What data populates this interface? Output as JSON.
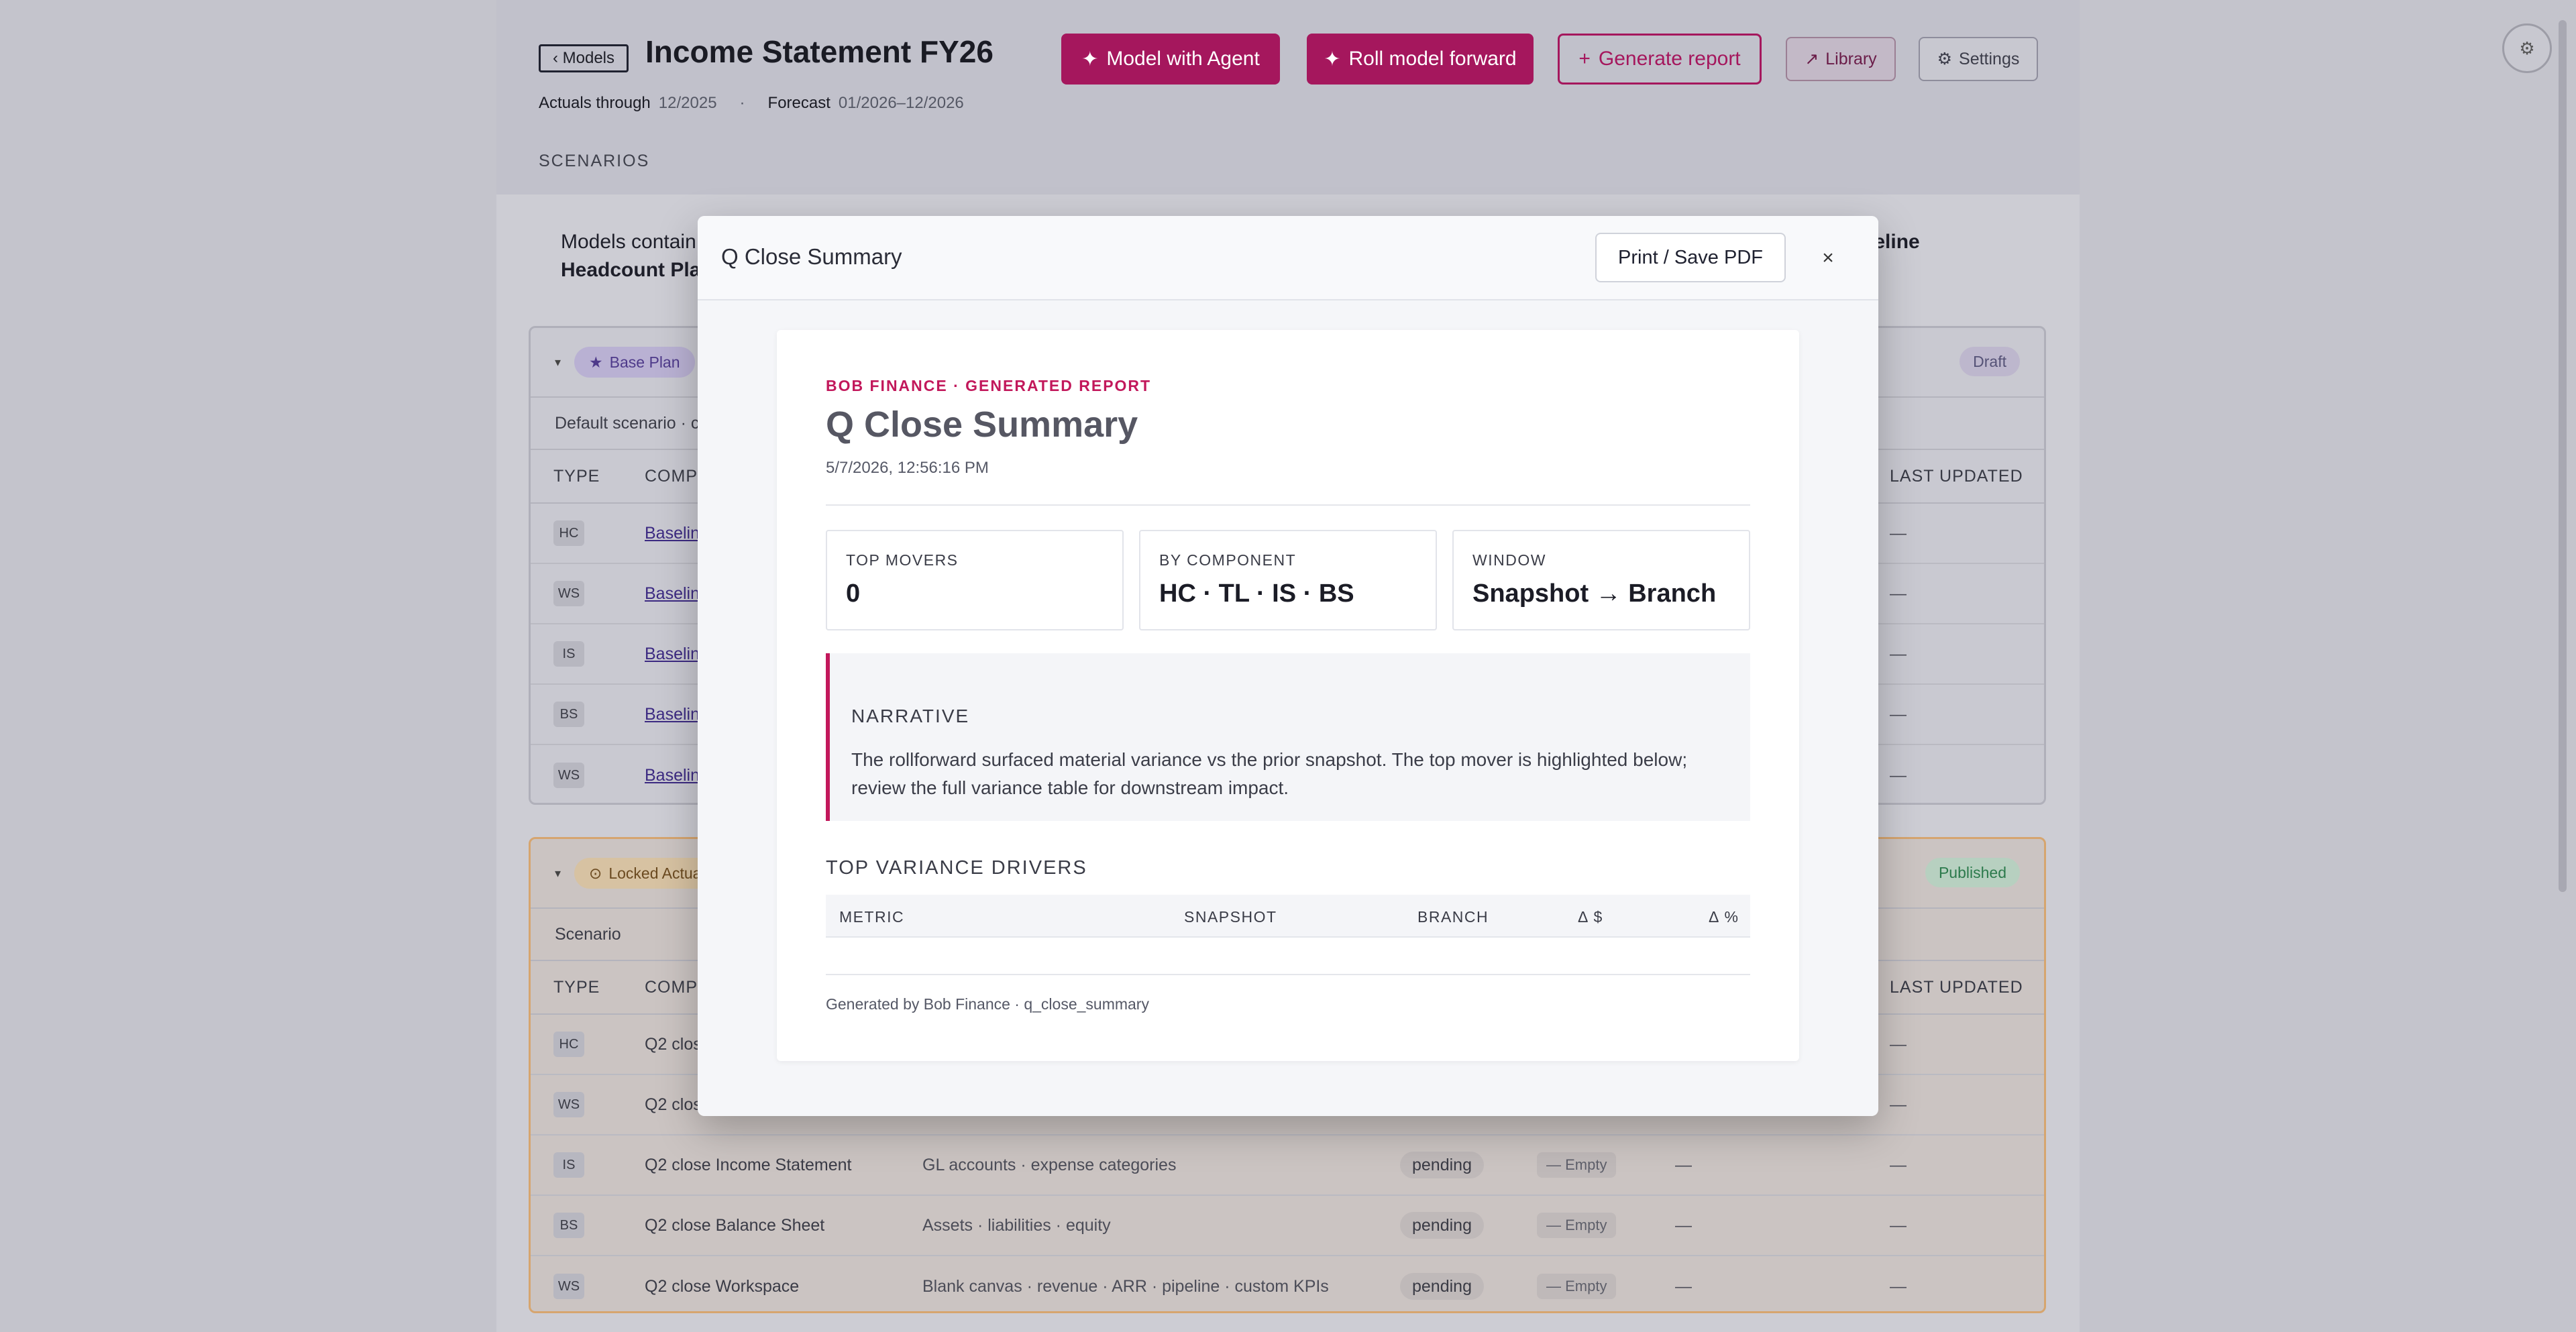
{
  "header": {
    "back_label": "‹ Models",
    "title": "Income Statement FY26",
    "actuals_label": "Actuals through",
    "actuals_value": "12/2025",
    "sep": "·",
    "forecast_label": "Forecast",
    "forecast_value": "01/2026–12/2026",
    "scenarios_label": "SCENARIOS"
  },
  "toolbar": {
    "model_agent": "Model with Agent",
    "roll_forward": "Roll model forward",
    "generate_report": "Generate report",
    "library": "Library",
    "settings": "Settings"
  },
  "info": {
    "line1": "Models contain",
    "line2": "Headcount Plan",
    "right1": "aseline"
  },
  "base_card": {
    "chip": "Base Plan",
    "status": "Draft",
    "sub": "Default scenario · c",
    "cols": {
      "type": "TYPE",
      "component": "COMPO",
      "last_updated": "LAST UPDATED"
    },
    "rows": [
      {
        "type": "HC",
        "comp": "Baselin",
        "updated": "—"
      },
      {
        "type": "WS",
        "comp": "Baselin",
        "updated": "—"
      },
      {
        "type": "IS",
        "comp": "Baselin",
        "updated": "—"
      },
      {
        "type": "BS",
        "comp": "Baselin",
        "updated": "—"
      },
      {
        "type": "WS",
        "comp": "Baselin",
        "updated": "—"
      }
    ]
  },
  "locked_card": {
    "chip": "Locked Actua",
    "status": "Published",
    "sub": "Scenario",
    "cols": {
      "type": "TYPE",
      "component": "COMPO",
      "last_updated": "LAST UPDATED"
    },
    "rows": [
      {
        "type": "HC",
        "comp": "Q2 clos",
        "desc": "",
        "pend": "",
        "empty": "",
        "d1": "",
        "updated": "—"
      },
      {
        "type": "WS",
        "comp": "Q2 clos",
        "desc": "",
        "pend": "",
        "empty": "",
        "d1": "",
        "updated": "—"
      },
      {
        "type": "IS",
        "comp": "Q2 close Income Statement",
        "desc": "GL accounts · expense categories",
        "pend": "pending",
        "empty": "— Empty",
        "d1": "—",
        "updated": "—"
      },
      {
        "type": "BS",
        "comp": "Q2 close Balance Sheet",
        "desc": "Assets · liabilities · equity",
        "pend": "pending",
        "empty": "— Empty",
        "d1": "—",
        "updated": "—"
      },
      {
        "type": "WS",
        "comp": "Q2 close Workspace",
        "desc": "Blank canvas · revenue · ARR · pipeline · custom KPIs",
        "pend": "pending",
        "empty": "— Empty",
        "d1": "—",
        "updated": "—"
      }
    ]
  },
  "modal": {
    "title": "Q Close Summary",
    "print_label": "Print / Save PDF",
    "close_label": "×",
    "report": {
      "brand": "BOB FINANCE · GENERATED REPORT",
      "title": "Q Close Summary",
      "date": "5/7/2026, 12:56:16 PM",
      "stats": [
        {
          "label": "TOP MOVERS",
          "value": "0"
        },
        {
          "label": "BY COMPONENT",
          "value": "HC · TL · IS · BS"
        },
        {
          "label": "WINDOW",
          "value": "Snapshot → Branch"
        }
      ],
      "narrative_head": "NARRATIVE",
      "narrative_body": "The rollforward surfaced material variance vs the prior snapshot. The top mover is highlighted below; review the full variance table for downstream impact.",
      "drivers_head": "TOP VARIANCE DRIVERS",
      "drivers_cols": [
        "METRIC",
        "SNAPSHOT",
        "BRANCH",
        "Δ $",
        "Δ %"
      ],
      "footer": "Generated by Bob Finance · q_close_summary"
    }
  },
  "colors": {
    "accent": "#c2185b",
    "button": "#a5175d"
  }
}
